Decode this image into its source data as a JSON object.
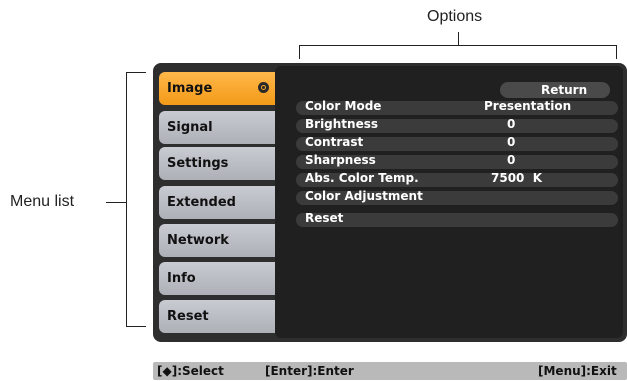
{
  "callouts": {
    "options": "Options",
    "menu_list": "Menu list"
  },
  "menu": [
    {
      "label": "Image",
      "active": true
    },
    {
      "label": "Signal",
      "active": false
    },
    {
      "label": "Settings",
      "active": false
    },
    {
      "label": "Extended",
      "active": false
    },
    {
      "label": "Network",
      "active": false
    },
    {
      "label": "Info",
      "active": false
    },
    {
      "label": "Reset",
      "active": false
    }
  ],
  "options": {
    "return_label": "Return",
    "items": [
      {
        "label": "Color Mode",
        "value": "Presentation"
      },
      {
        "label": "Brightness",
        "value": "0"
      },
      {
        "label": "Contrast",
        "value": "0"
      },
      {
        "label": "Sharpness",
        "value": "0"
      },
      {
        "label": "Abs. Color Temp.",
        "value": "7500  K"
      },
      {
        "label": "Color Adjustment",
        "value": ""
      },
      {
        "label": "Reset",
        "value": ""
      }
    ]
  },
  "footer": {
    "select": "[◆]:Select",
    "enter": "[Enter]:Enter",
    "exit": "[Menu]:Exit"
  },
  "colors": {
    "active_tab": "#f39a18",
    "panel": "#202020"
  }
}
